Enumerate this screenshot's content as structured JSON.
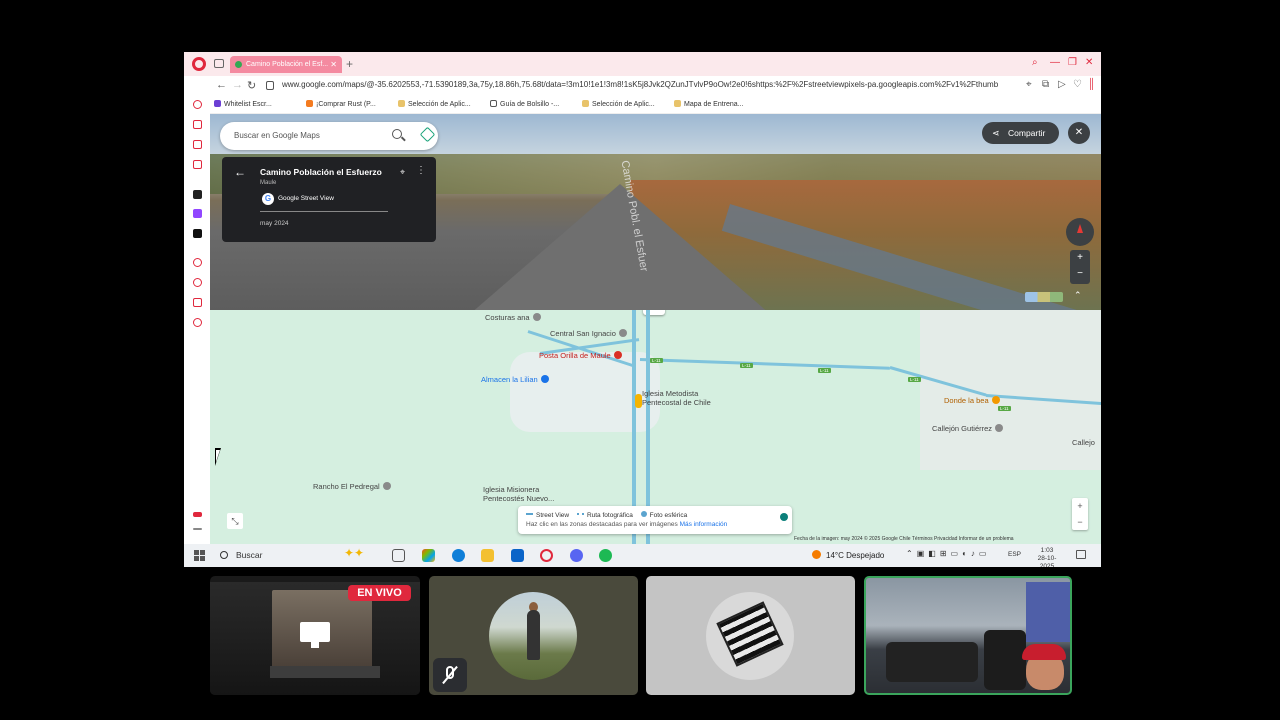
{
  "browser": {
    "tab_title": "Camino Población el Esf...",
    "url": "www.google.com/maps/@-35.6202553,-71.5390189,3a,75y,18.86h,75.68t/data=!3m10!1e1!3m8!1sK5j8Jvk2QZunJTvlvP9oOw!2e0!6shttps:%2F%2Fstreetviewpixels-pa.googleapis.com%2Fv1%2Fthumb",
    "bookmarks": [
      {
        "label": "Whitelist Escr...",
        "color": "#6b3fd4"
      },
      {
        "label": "¡Comprar Rust (P...",
        "color": "#f47b20"
      },
      {
        "label": "Selección de Aplic...",
        "color": "#e8c36a"
      },
      {
        "label": "Guía de Bolsillo -...",
        "color": "#555555"
      },
      {
        "label": "Selección de Aplic...",
        "color": "#e8c36a"
      },
      {
        "label": "Mapa de Entrena...",
        "color": "#e8c36a"
      }
    ]
  },
  "maps": {
    "search_placeholder": "Buscar en Google Maps",
    "place_title": "Camino Población el Esfuerzo",
    "place_region": "Maule",
    "source_label": "Google Street View",
    "capture_date": "may 2024",
    "road_label": "Camino Pobl. el Esfuer",
    "share_label": "Compartir",
    "pois": {
      "costuras": "Costuras ana",
      "central": "Central San Ignacio",
      "posta": "Posta Orilla de Maule",
      "almacen": "Almacen la Lilian",
      "iglesia_metodista_1": "Iglesia Metodista",
      "iglesia_metodista_2": "Pentecostal de Chile",
      "donde_bea": "Donde la bea",
      "callejon_gutierrez": "Callejón Gutiérrez",
      "callejon": "Callejo",
      "rancho": "Rancho El Pedregal",
      "iglesia_misionera_1": "Iglesia Misionera",
      "iglesia_misionera_2": "Pentecostés Nuevo..."
    },
    "road_shield": "L-11",
    "legend": {
      "street_view": "Street View",
      "route": "Ruta fotográfica",
      "sphere": "Foto esférica",
      "hint": "Haz clic en las zonas destacadas para ver imágenes",
      "more_info": "Más información"
    },
    "attribution": "Fecha de la imagen: may 2024    © 2025 Google    Chile    Términos    Privacidad    Informar de un problema"
  },
  "taskbar": {
    "search_label": "Buscar",
    "weather": "14°C  Despejado",
    "language": "ESP",
    "time": "1:03",
    "date": "28-10-2025"
  },
  "call": {
    "live_label": "EN VIVO"
  },
  "colors": {
    "opera_red": "#e0283d",
    "map_green": "#d5efe0",
    "street_view_blue": "#7fc3dc",
    "active_speaker": "#3ba55c"
  }
}
